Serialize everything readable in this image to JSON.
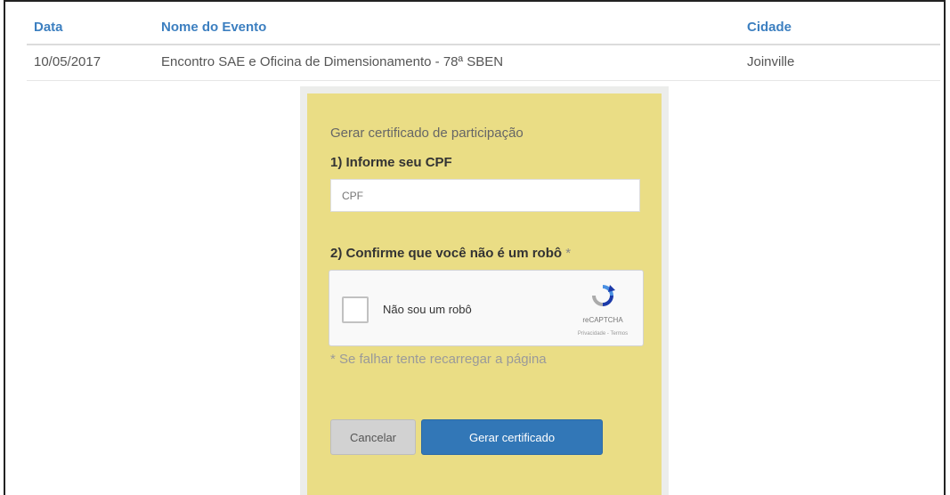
{
  "table": {
    "headers": {
      "date": "Data",
      "name": "Nome do Evento",
      "city": "Cidade"
    },
    "rows": [
      {
        "date": "10/05/2017",
        "name": "Encontro SAE e Oficina de Dimensionamento - 78ª SBEN",
        "city": "Joinville"
      }
    ]
  },
  "panel": {
    "title": "Gerar certificado de participação",
    "step1": "1) Informe seu CPF",
    "cpf_placeholder": "CPF",
    "cpf_value": "",
    "step2": "2) Confirme que você não é um robô",
    "step2_required": "*",
    "recaptcha": {
      "label": "Não sou um robô",
      "brand": "reCAPTCHA",
      "links": "Privacidade - Termos"
    },
    "hint": "* Se falhar tente recarregar a página",
    "cancel_label": "Cancelar",
    "generate_label": "Gerar certificado"
  },
  "colors": {
    "header_text": "#3c7fc0",
    "panel_bg": "#eadd85",
    "primary_button": "#3277b7"
  },
  "icons": {
    "recaptcha": "recaptcha-logo-icon"
  }
}
